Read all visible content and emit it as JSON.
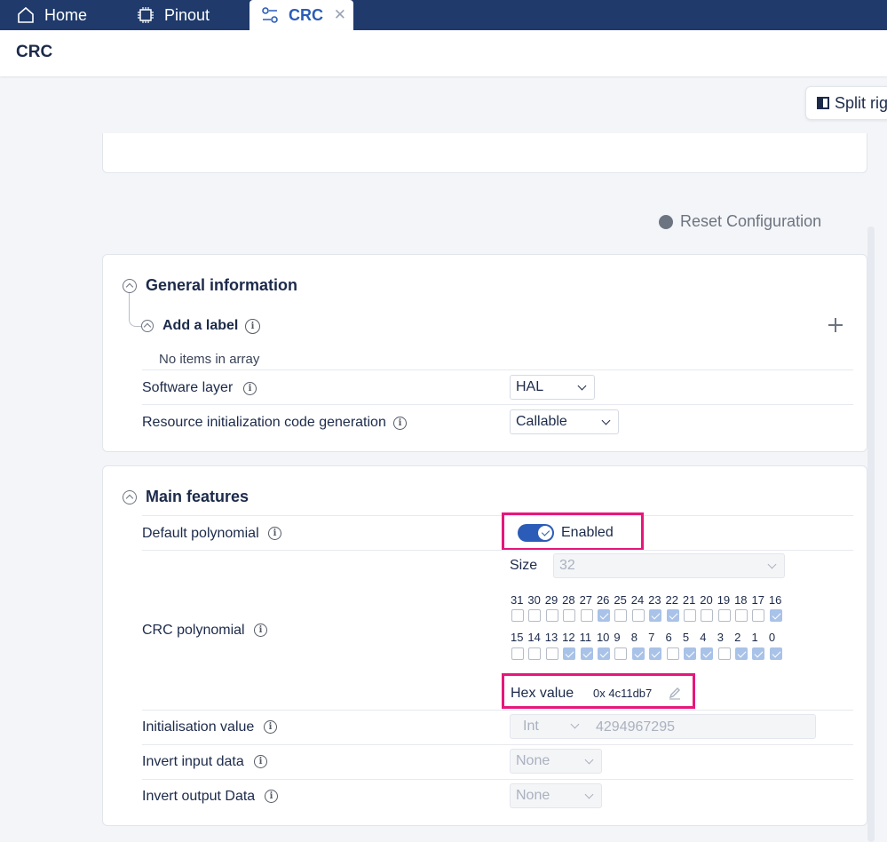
{
  "tabs": [
    {
      "label": "Home",
      "icon": "home-icon"
    },
    {
      "label": "Pinout",
      "icon": "chip-icon"
    },
    {
      "label": "CRC",
      "icon": "settings-icon",
      "active": true
    }
  ],
  "header": {
    "title": "CRC"
  },
  "split_button": {
    "label": "Split rig"
  },
  "reset": {
    "label": "Reset Configuration"
  },
  "general": {
    "title": "General information",
    "add_label": "Add a label",
    "empty_text": "No items in array",
    "software_layer": {
      "label": "Software layer",
      "value": "HAL"
    },
    "resource_init": {
      "label": "Resource initialization code generation",
      "value": "Callable"
    }
  },
  "main": {
    "title": "Main features",
    "default_polynomial": {
      "label": "Default polynomial",
      "toggle_label": "Enabled",
      "enabled": true
    },
    "crc_polynomial": {
      "label": "CRC polynomial",
      "size_label": "Size",
      "size_value": "32",
      "row1_bits": [
        "31",
        "30",
        "29",
        "28",
        "27",
        "26",
        "25",
        "24",
        "23",
        "22",
        "21",
        "20",
        "19",
        "18",
        "17",
        "16"
      ],
      "row1_checked": [
        false,
        false,
        false,
        false,
        false,
        true,
        false,
        false,
        true,
        true,
        false,
        false,
        false,
        false,
        false,
        true
      ],
      "row2_bits": [
        "15",
        "14",
        "13",
        "12",
        "11",
        "10",
        "9",
        "8",
        "7",
        "6",
        "5",
        "4",
        "3",
        "2",
        "1",
        "0"
      ],
      "row2_checked": [
        false,
        false,
        false,
        true,
        true,
        true,
        false,
        true,
        true,
        false,
        true,
        true,
        false,
        true,
        true,
        true
      ],
      "hex_label": "Hex value",
      "hex_value": "0x 4c11db7"
    },
    "init_value": {
      "label": "Initialisation value",
      "type": "Int",
      "value": "4294967295"
    },
    "invert_input": {
      "label": "Invert input data",
      "value": "None"
    },
    "invert_output": {
      "label": "Invert output Data",
      "value": "None"
    }
  },
  "colors": {
    "accent": "#2b5cb8",
    "tabbar": "#1f3a6b",
    "highlight": "#e6177a"
  }
}
